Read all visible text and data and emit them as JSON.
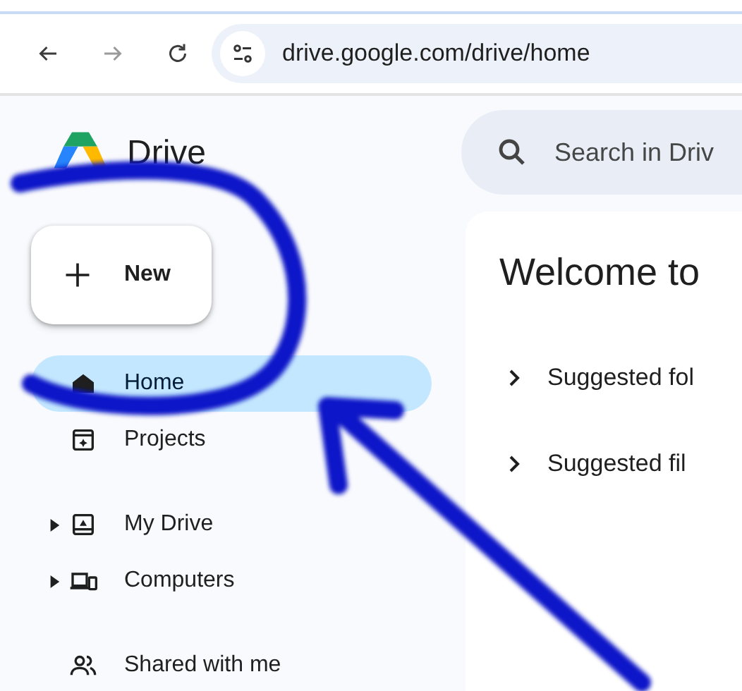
{
  "browser": {
    "url": "drive.google.com/drive/home"
  },
  "app": {
    "name": "Drive",
    "search": {
      "placeholder": "Search in Driv"
    }
  },
  "new_button": {
    "label": "New"
  },
  "sidebar": {
    "sections": [
      [
        {
          "label": "Home",
          "selected": true
        },
        {
          "label": "Projects",
          "selected": false
        }
      ],
      [
        {
          "label": "My Drive",
          "selected": false,
          "expanded": false
        },
        {
          "label": "Computers",
          "selected": false,
          "expanded": false
        }
      ],
      [
        {
          "label": "Shared with me",
          "selected": false
        }
      ]
    ]
  },
  "main": {
    "title": "Welcome to",
    "sections": [
      {
        "label": "Suggested fol",
        "expanded": false
      },
      {
        "label": "Suggested fil",
        "expanded": false
      }
    ]
  }
}
